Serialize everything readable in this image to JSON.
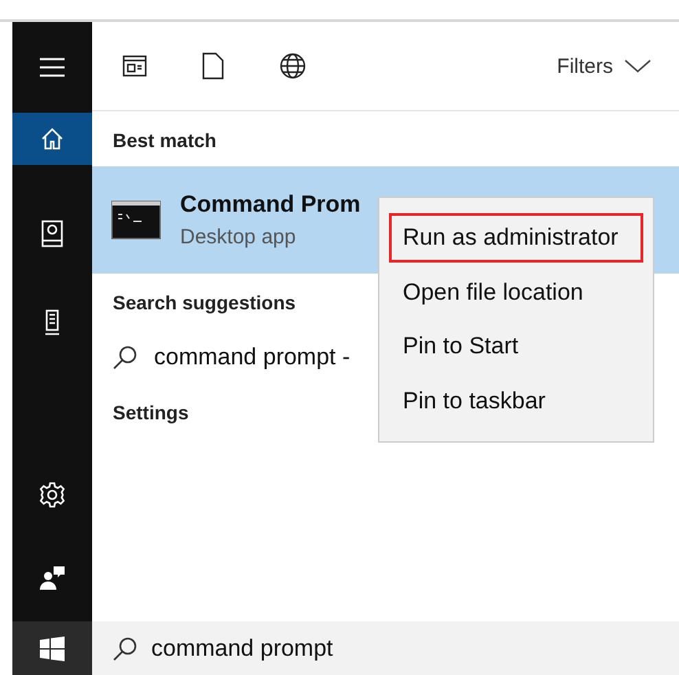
{
  "sidebar": {
    "items": [
      {
        "kind": "menu",
        "selected": false
      },
      {
        "kind": "home",
        "selected": true
      },
      {
        "kind": "documents",
        "selected": false
      },
      {
        "kind": "device",
        "selected": false
      },
      {
        "kind": "settings",
        "selected": false
      },
      {
        "kind": "feedback",
        "selected": false
      },
      {
        "kind": "start",
        "selected": false
      }
    ]
  },
  "toolbar": {
    "filters": "Filters"
  },
  "best_match": {
    "heading": "Best match",
    "result": {
      "title": "Command Prom",
      "subtitle": "Desktop app",
      "selected": true
    }
  },
  "search_suggestions": {
    "heading": "Search suggestions",
    "items": [
      "command prompt -"
    ]
  },
  "settings": {
    "heading": "Settings"
  },
  "context_menu": {
    "items": [
      {
        "label": "Run as administrator",
        "highlighted": true
      },
      {
        "label": "Open file location",
        "highlighted": false
      },
      {
        "label": "Pin to Start",
        "highlighted": false
      },
      {
        "label": "Pin to taskbar",
        "highlighted": false
      }
    ]
  },
  "search_box": {
    "value": "command prompt"
  }
}
